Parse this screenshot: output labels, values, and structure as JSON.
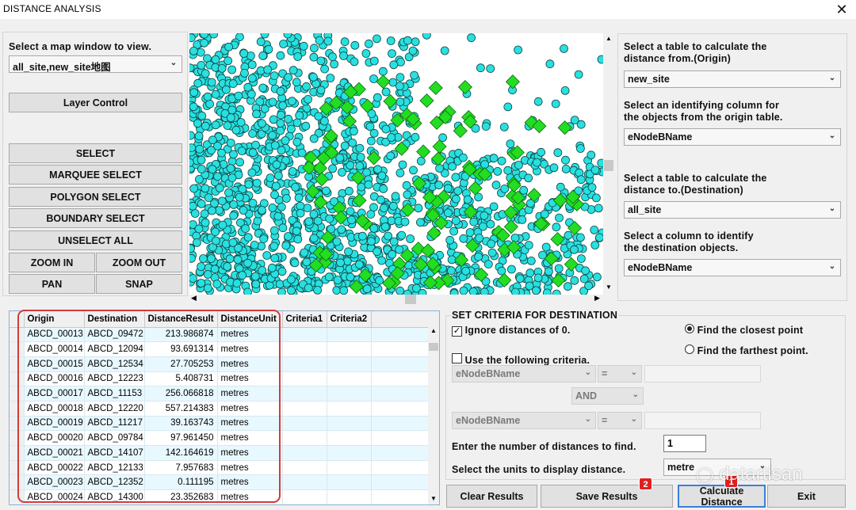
{
  "window": {
    "title": "DISTANCE ANALYSIS",
    "close_glyph": "✕"
  },
  "left": {
    "map_select_label": "Select a map window to view.",
    "map_window": "all_site,new_site地图",
    "layer_control": "Layer Control",
    "buttons": {
      "select": "SELECT",
      "marquee": "MARQUEE SELECT",
      "polygon": "POLYGON SELECT",
      "boundary": "BOUNDARY SELECT",
      "unselect": "UNSELECT ALL",
      "zoom_in": "ZOOM IN",
      "zoom_out": "ZOOM OUT",
      "pan": "PAN",
      "snap": "SNAP"
    }
  },
  "right": {
    "origin_table_label_1": "Select a table to calculate the",
    "origin_table_label_2": "distance from.(Origin)",
    "origin_table": "new_site",
    "origin_col_label_1": "Select an identifying column for",
    "origin_col_label_2": "the objects from the origin table.",
    "origin_col": "eNodeBName",
    "dest_table_label_1": "Select a table to calculate the",
    "dest_table_label_2": "distance to.(Destination)",
    "dest_table": "all_site",
    "dest_col_label_1": "Select a column to identify",
    "dest_col_label_2": "the destination objects.",
    "dest_col": "eNodeBName"
  },
  "results": {
    "columns": [
      "Origin",
      "Destination",
      "DistanceResult",
      "DistanceUnit",
      "Criteria1",
      "Criteria2"
    ],
    "rows": [
      [
        "ABCD_00013",
        "ABCD_09472",
        "213.986874",
        "metres",
        "",
        ""
      ],
      [
        "ABCD_00014",
        "ABCD_12094",
        "93.691314",
        "metres",
        "",
        ""
      ],
      [
        "ABCD_00015",
        "ABCD_12534",
        "27.705253",
        "metres",
        "",
        ""
      ],
      [
        "ABCD_00016",
        "ABCD_12223",
        "5.408731",
        "metres",
        "",
        ""
      ],
      [
        "ABCD_00017",
        "ABCD_11153",
        "256.066818",
        "metres",
        "",
        ""
      ],
      [
        "ABCD_00018",
        "ABCD_12220",
        "557.214383",
        "metres",
        "",
        ""
      ],
      [
        "ABCD_00019",
        "ABCD_11217",
        "39.163743",
        "metres",
        "",
        ""
      ],
      [
        "ABCD_00020",
        "ABCD_09784",
        "97.961450",
        "metres",
        "",
        ""
      ],
      [
        "ABCD_00021",
        "ABCD_14107",
        "142.164619",
        "metres",
        "",
        ""
      ],
      [
        "ABCD_00022",
        "ABCD_12133",
        "7.957683",
        "metres",
        "",
        ""
      ],
      [
        "ABCD_00023",
        "ABCD_12352",
        "0.111195",
        "metres",
        "",
        ""
      ],
      [
        "ABCD_00024",
        "ABCD_14300",
        "23.352683",
        "metres",
        "",
        ""
      ]
    ]
  },
  "criteria": {
    "header": "SET CRITERIA FOR DESTINATION",
    "ignore_zero": "Ignore distances of 0.",
    "ignore_zero_checked": true,
    "closest": "Find the closest point",
    "farthest": "Find the farthest point.",
    "use_criteria": "Use the following criteria.",
    "field1": "eNodeBName",
    "op1": "=",
    "logic": "AND",
    "field2": "eNodeBName",
    "op2": "=",
    "num_label": "Enter the number of distances to find.",
    "num_value": "1",
    "units_label": "Select the units to display distance.",
    "units_value": "metre"
  },
  "bottom": {
    "clear": "Clear Results",
    "save": "Save Results",
    "calculate": "Calculate Distance",
    "exit": "Exit",
    "badge_save": "2",
    "badge_calc": "1"
  },
  "watermark": "datartisan",
  "colors": {
    "site_dot": "#28e0e0",
    "new_site": "#22dd22",
    "badge": "#e02020",
    "annotation": "#d23a3a"
  }
}
